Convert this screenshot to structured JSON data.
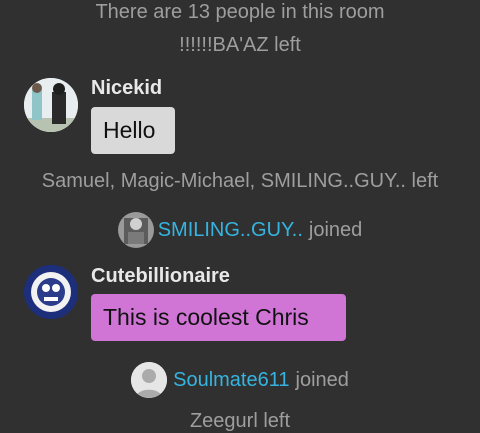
{
  "system_messages": {
    "room_count": "There are 13 people in this room",
    "left_1": "!!!!!!BA'AZ left",
    "left_2": "Samuel, Magic-Michael, SMILING..GUY.. left",
    "left_3": "Zeegurl left"
  },
  "joins": [
    {
      "user": "SMILING..GUY..",
      "action": "joined"
    },
    {
      "user": "Soulmate611",
      "action": "joined"
    }
  ],
  "messages": [
    {
      "sender": "Nicekid",
      "text": "Hello",
      "bubble_color": "#d9d9d9"
    },
    {
      "sender": "Cutebillionaire",
      "text": "This is coolest Chris",
      "bubble_color": "#d075d6"
    }
  ],
  "colors": {
    "background": "#303030",
    "link": "#36b4e0",
    "system_text": "#9e9e9e"
  }
}
